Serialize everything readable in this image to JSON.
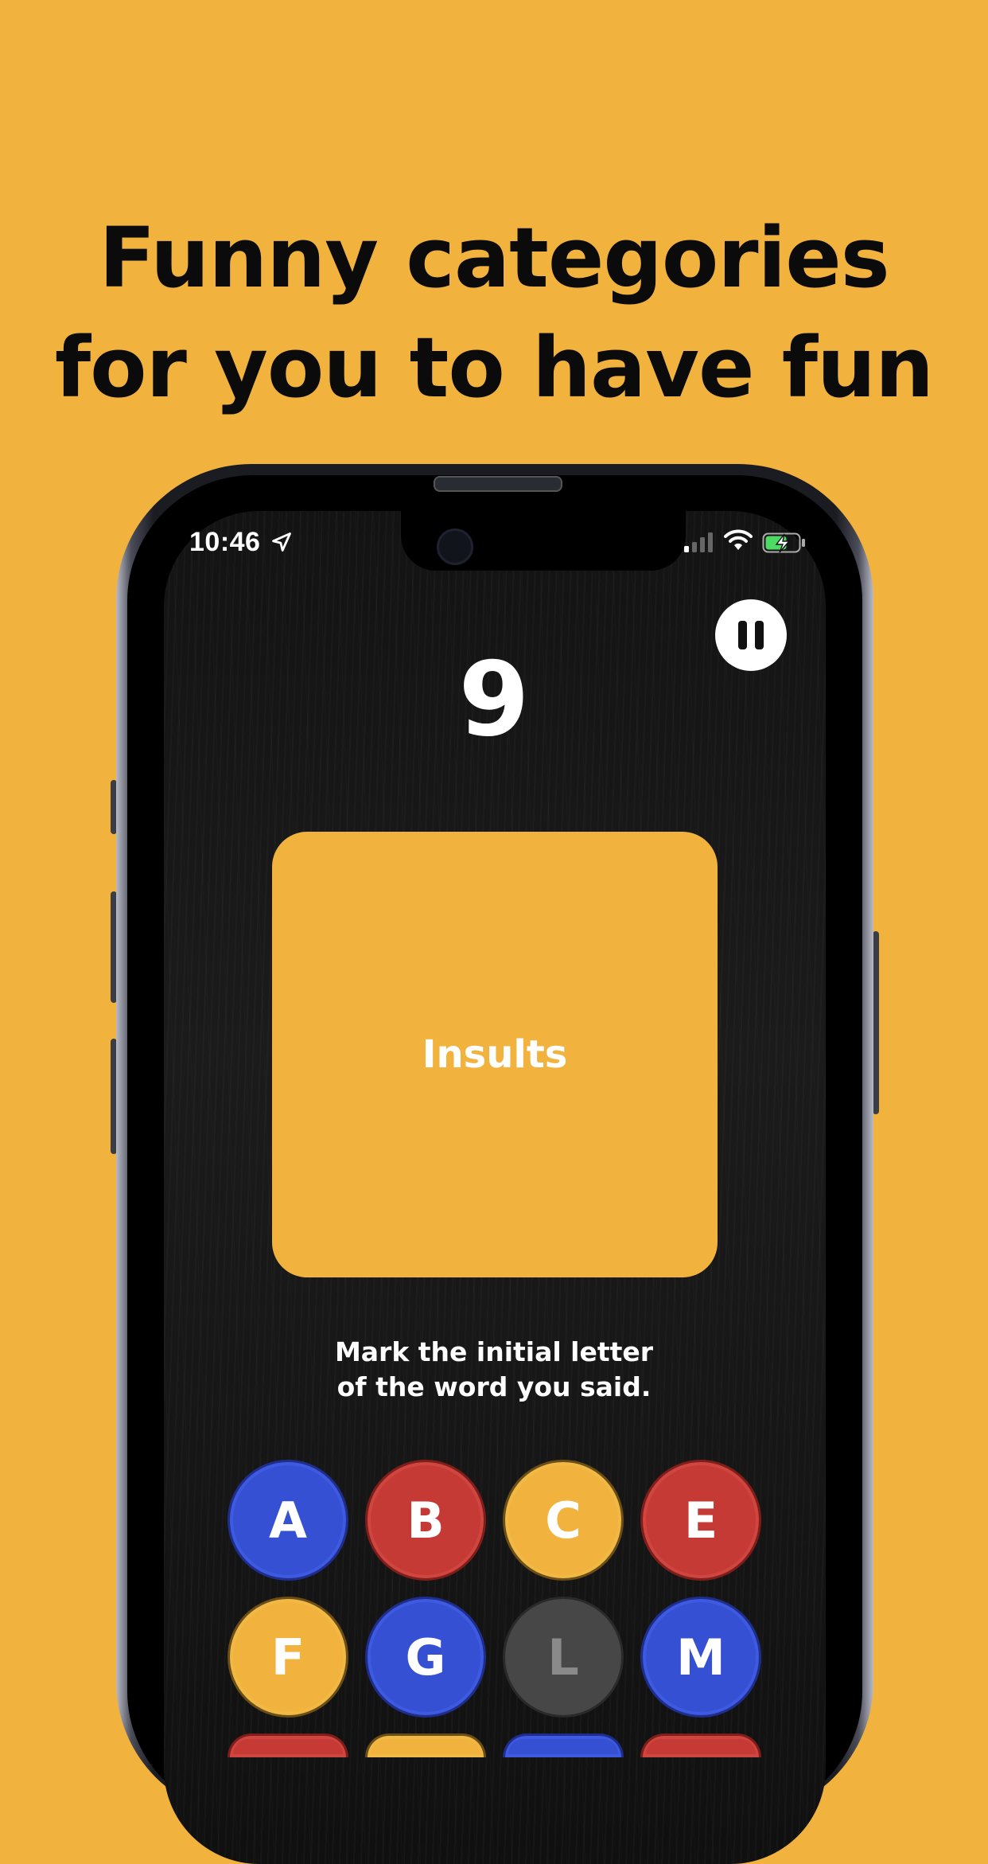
{
  "headline": {
    "line1": "Funny categories",
    "line2": "for you to have fun"
  },
  "status_bar": {
    "time": "10:46",
    "location_icon": "location-arrow-icon",
    "signal_icon": "cellular-signal-icon",
    "wifi_icon": "wifi-icon",
    "battery_icon": "battery-charging-icon"
  },
  "game": {
    "counter": "9",
    "category": "Insults",
    "instruction_line1": "Mark the initial letter",
    "instruction_line2": "of the word you said.",
    "pause_icon": "pause-icon"
  },
  "letters": [
    {
      "label": "A",
      "color": "#3550D2",
      "disabled": false
    },
    {
      "label": "B",
      "color": "#C53A34",
      "disabled": false
    },
    {
      "label": "C",
      "color": "#F2B33E",
      "disabled": false
    },
    {
      "label": "E",
      "color": "#C53A34",
      "disabled": false
    },
    {
      "label": "F",
      "color": "#F2B33E",
      "disabled": false
    },
    {
      "label": "G",
      "color": "#3550D2",
      "disabled": false
    },
    {
      "label": "L",
      "color": "#474747",
      "disabled": true
    },
    {
      "label": "M",
      "color": "#3550D2",
      "disabled": false
    },
    {
      "label": "",
      "color": "#C53A34",
      "disabled": false
    },
    {
      "label": "",
      "color": "#F2B33E",
      "disabled": false
    },
    {
      "label": "",
      "color": "#3550D2",
      "disabled": false
    },
    {
      "label": "",
      "color": "#C53A34",
      "disabled": false
    }
  ],
  "colors": {
    "background": "#F2B33E",
    "card": "#F2B33E",
    "blue": "#3550D2",
    "red": "#C53A34",
    "disabled": "#474747"
  }
}
